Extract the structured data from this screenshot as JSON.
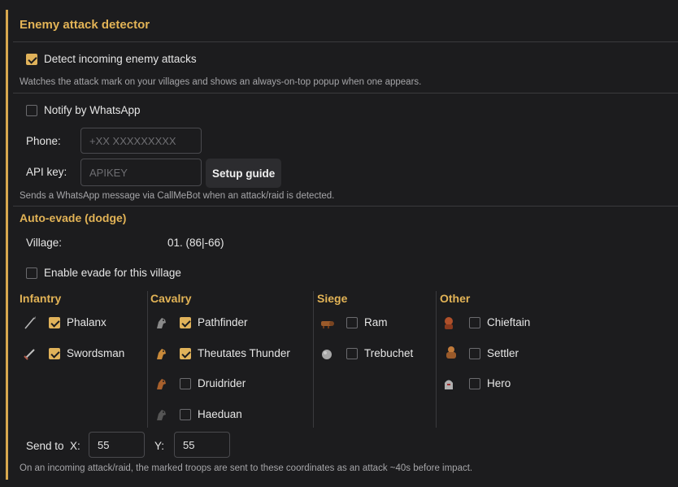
{
  "detector": {
    "title": "Enemy attack detector",
    "detect_label": "Detect incoming enemy attacks",
    "detect_checked": true,
    "detect_description": "Watches the attack mark on your villages and shows an always-on-top popup when one appears."
  },
  "whatsapp": {
    "notify_label": "Notify by WhatsApp",
    "notify_checked": false,
    "phone_label": "Phone:",
    "phone_placeholder": "+XX XXXXXXXXX",
    "phone_value": "",
    "apikey_label": "API key:",
    "apikey_placeholder": "APIKEY",
    "apikey_value": "",
    "setup_guide_label": "Setup guide",
    "description": "Sends a WhatsApp message via CallMeBot when an attack/raid is detected."
  },
  "evade": {
    "title": "Auto-evade (dodge)",
    "village_label": "Village:",
    "village_value": "01. (86|-66)",
    "enable_label": "Enable evade for this village",
    "enable_checked": false,
    "groups": {
      "infantry": {
        "title": "Infantry",
        "troops": [
          {
            "name": "Phalanx",
            "checked": true,
            "icon": "spear-icon"
          },
          {
            "name": "Swordsman",
            "checked": true,
            "icon": "sword-icon"
          }
        ]
      },
      "cavalry": {
        "title": "Cavalry",
        "troops": [
          {
            "name": "Pathfinder",
            "checked": true,
            "icon": "horse-icon"
          },
          {
            "name": "Theutates Thunder",
            "checked": true,
            "icon": "horse-icon"
          },
          {
            "name": "Druidrider",
            "checked": false,
            "icon": "horse-icon"
          },
          {
            "name": "Haeduan",
            "checked": false,
            "icon": "horse-icon"
          }
        ]
      },
      "siege": {
        "title": "Siege",
        "troops": [
          {
            "name": "Ram",
            "checked": false,
            "icon": "ram-icon"
          },
          {
            "name": "Trebuchet",
            "checked": false,
            "icon": "stone-icon"
          }
        ]
      },
      "other": {
        "title": "Other",
        "troops": [
          {
            "name": "Chieftain",
            "checked": false,
            "icon": "chieftain-icon"
          },
          {
            "name": "Settler",
            "checked": false,
            "icon": "settler-icon"
          },
          {
            "name": "Hero",
            "checked": false,
            "icon": "hero-icon"
          }
        ]
      }
    },
    "send_to_label": "Send to  X:",
    "x_value": "55",
    "y_label": "Y:",
    "y_value": "55",
    "description": "On an incoming attack/raid, the marked troops are sent to these coordinates as an attack ~40s before impact."
  },
  "colors": {
    "accent": "#d8a84e",
    "heading": "#e2b356",
    "background": "#1c1c1e"
  }
}
